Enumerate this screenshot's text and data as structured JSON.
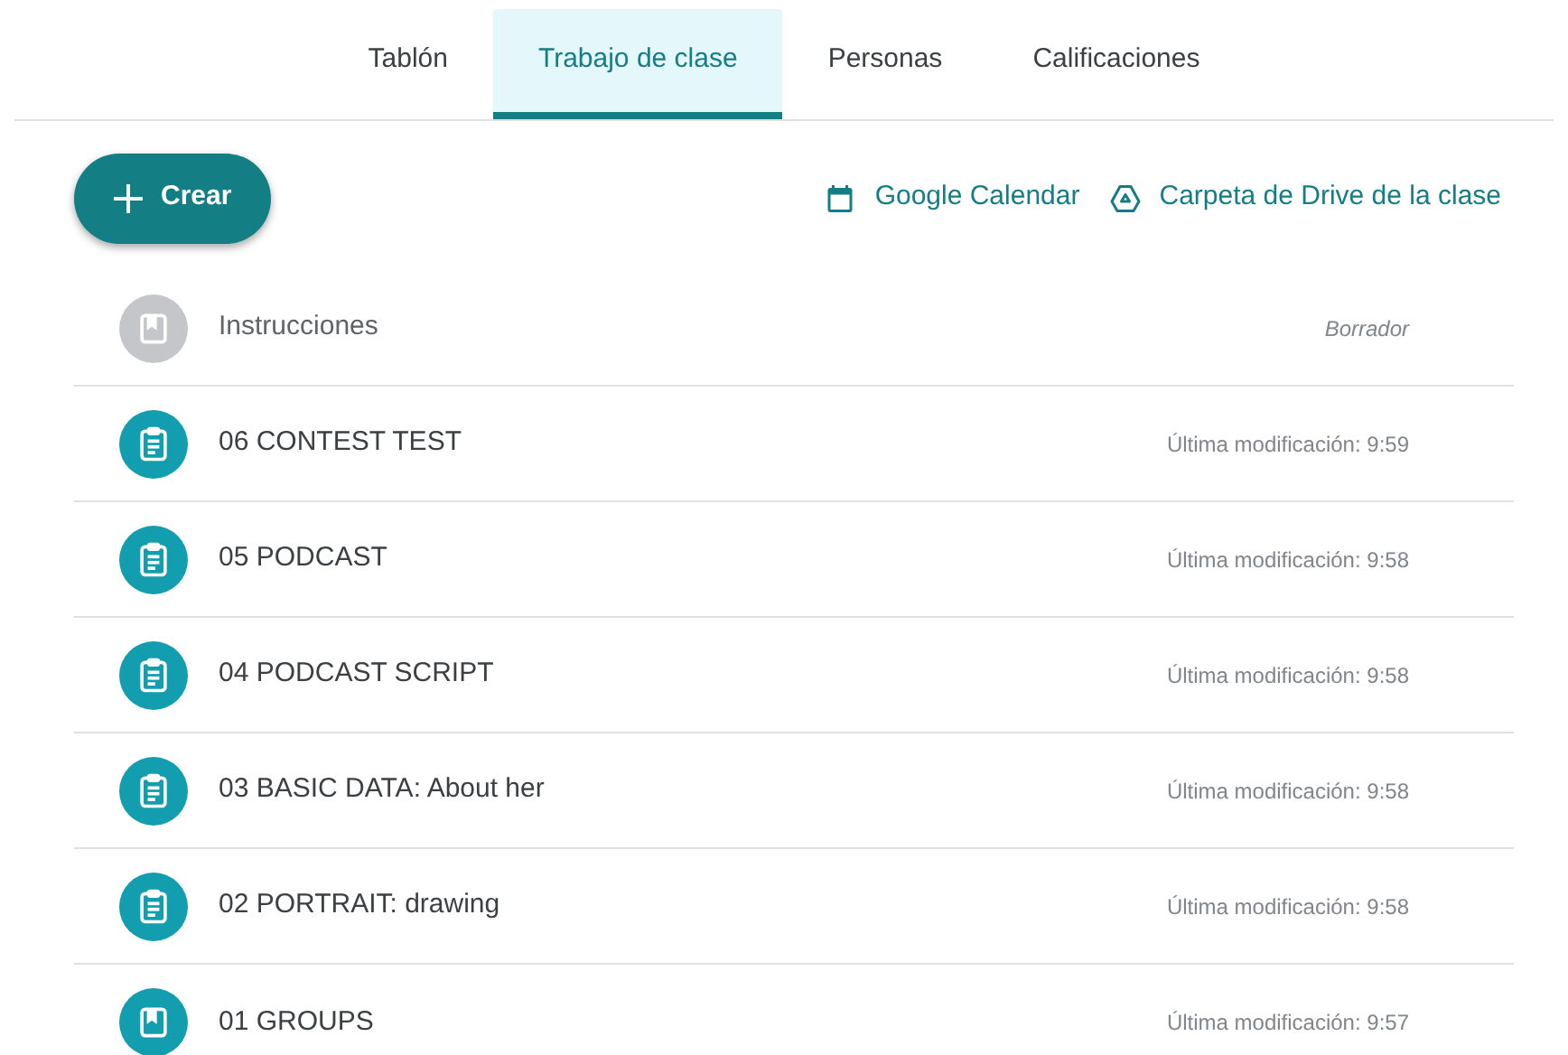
{
  "tabs": [
    {
      "label": "Tablón",
      "selected": false
    },
    {
      "label": "Trabajo de clase",
      "selected": true
    },
    {
      "label": "Personas",
      "selected": false
    },
    {
      "label": "Calificaciones",
      "selected": false
    }
  ],
  "create_button": {
    "label": "Crear"
  },
  "links": [
    {
      "kind": "calendar",
      "label": "Google Calendar"
    },
    {
      "kind": "drive",
      "label": "Carpeta de Drive de la clase"
    }
  ],
  "items": [
    {
      "kind": "material",
      "title": "Instrucciones",
      "status": "Borrador",
      "draft": true
    },
    {
      "kind": "assignment",
      "title": "06 CONTEST TEST",
      "status": "Última modificación: 9:59",
      "draft": false
    },
    {
      "kind": "assignment",
      "title": "05 PODCAST",
      "status": "Última modificación: 9:58",
      "draft": false
    },
    {
      "kind": "assignment",
      "title": "04 PODCAST SCRIPT",
      "status": "Última modificación: 9:58",
      "draft": false
    },
    {
      "kind": "assignment",
      "title": "03 BASIC DATA: About her",
      "status": "Última modificación: 9:58",
      "draft": false
    },
    {
      "kind": "assignment",
      "title": "02 PORTRAIT: drawing",
      "status": "Última modificación: 9:58",
      "draft": false
    },
    {
      "kind": "material",
      "title": "01 GROUPS",
      "status": "Última modificación: 9:57",
      "draft": false
    }
  ]
}
